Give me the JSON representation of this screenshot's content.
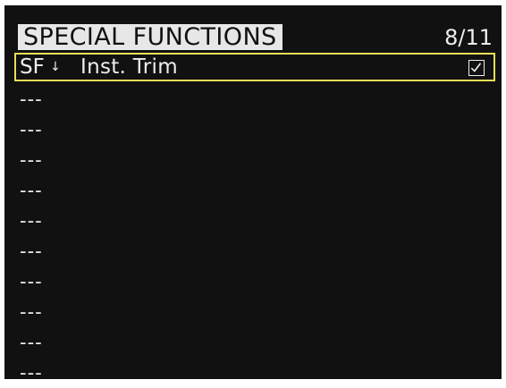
{
  "header": {
    "title": "SPECIAL FUNCTIONS",
    "page_indicator": "8/11"
  },
  "selected_function": {
    "prefix": "SF",
    "arrow_glyph": "↓",
    "name": "Inst. Trim",
    "enabled": true,
    "check_icon": "checkbox-checked-icon"
  },
  "empty_rows": [
    "---",
    "---",
    "---",
    "---",
    "---",
    "---",
    "---",
    "---",
    "---",
    "---"
  ],
  "colors": {
    "background": "#111111",
    "text": "#eeeeee",
    "header_bg": "#e7e7e7",
    "selection_border": "#e8df55"
  }
}
